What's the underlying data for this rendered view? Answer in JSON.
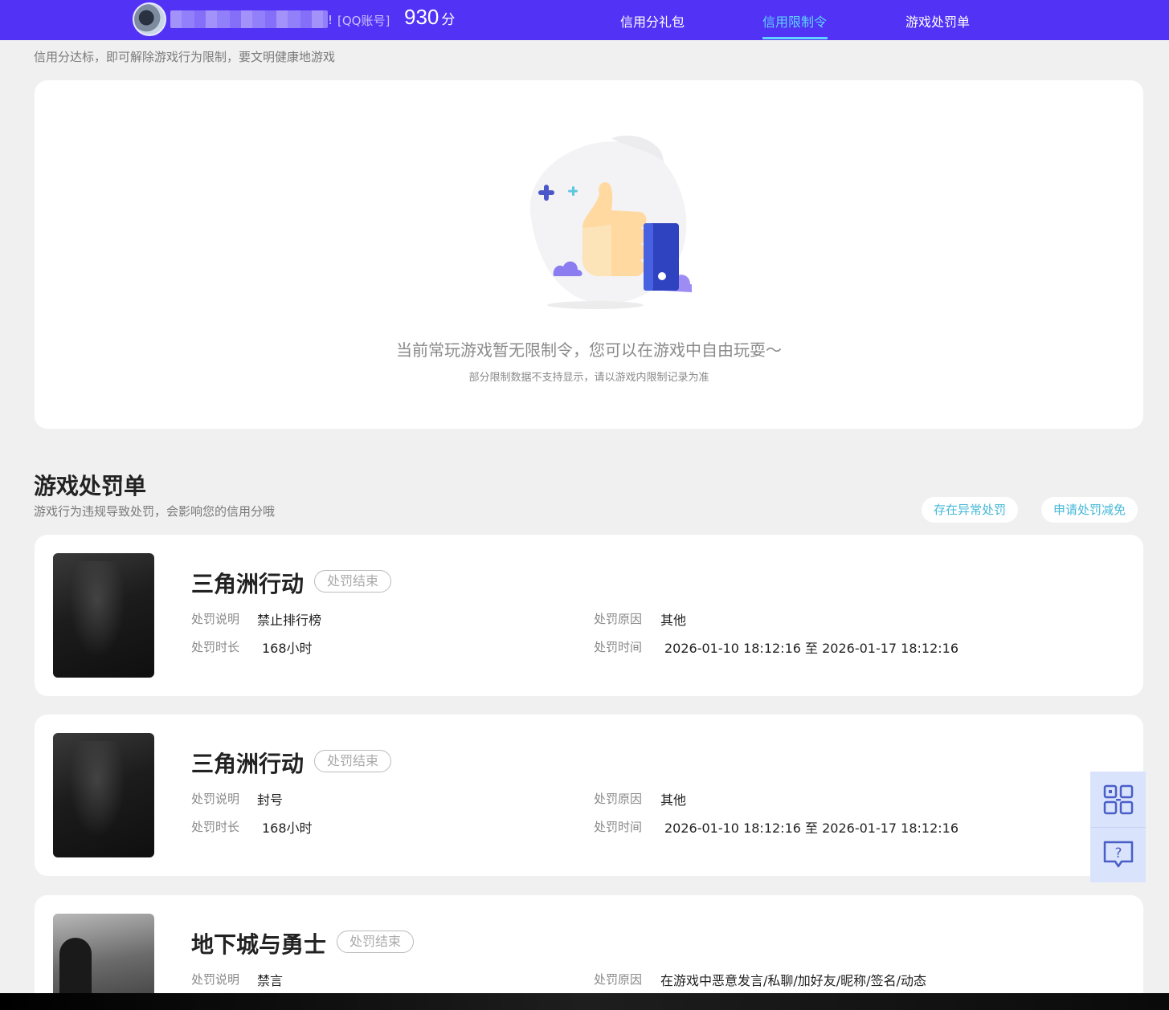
{
  "header": {
    "name_suffix": "!",
    "account_tag": "[QQ账号]",
    "score_value": "930",
    "score_unit": "分",
    "nav": [
      {
        "label": "信用分礼包",
        "active": false
      },
      {
        "label": "信用限制令",
        "active": true
      },
      {
        "label": "游戏处罚单",
        "active": false
      }
    ],
    "accent_color": "#5232f5",
    "active_color": "#5fd2ff"
  },
  "limit_section": {
    "subtitle": "信用分达标，即可解除游戏行为限制，要文明健康地游戏",
    "empty_main": "当前常玩游戏暂无限制令，您可以在游戏中自由玩耍～",
    "empty_sub": "部分限制数据不支持显示，请以游戏内限制记录为准",
    "illustration": "thumbs-up-icon"
  },
  "penalty_section": {
    "title": "游戏处罚单",
    "desc": "游戏行为违规导致处罚，会影响您的信用分哦",
    "btn_abnormal": "存在异常处罚",
    "btn_appeal": "申请处罚减免",
    "labels": {
      "explain": "处罚说明",
      "reason": "处罚原因",
      "duration": "处罚时长",
      "time": "处罚时间"
    },
    "items": [
      {
        "game": "三角洲行动",
        "status": "处罚结束",
        "explain": "禁止排行榜",
        "reason": "其他",
        "duration": "168小时",
        "time": "2026-01-10 18:12:16 至 2026-01-17 18:12:16"
      },
      {
        "game": "三角洲行动",
        "status": "处罚结束",
        "explain": "封号",
        "reason": "其他",
        "duration": "168小时",
        "time": "2026-01-10 18:12:16 至 2026-01-17 18:12:16"
      },
      {
        "game": "地下城与勇士",
        "status": "处罚结束",
        "explain": "禁言",
        "reason": "在游戏中恶意发言/私聊/加好友/昵称/签名/动态"
      }
    ]
  },
  "side_float": {
    "qr_icon": "qr-code-icon",
    "help_icon": "help-chat-icon"
  }
}
